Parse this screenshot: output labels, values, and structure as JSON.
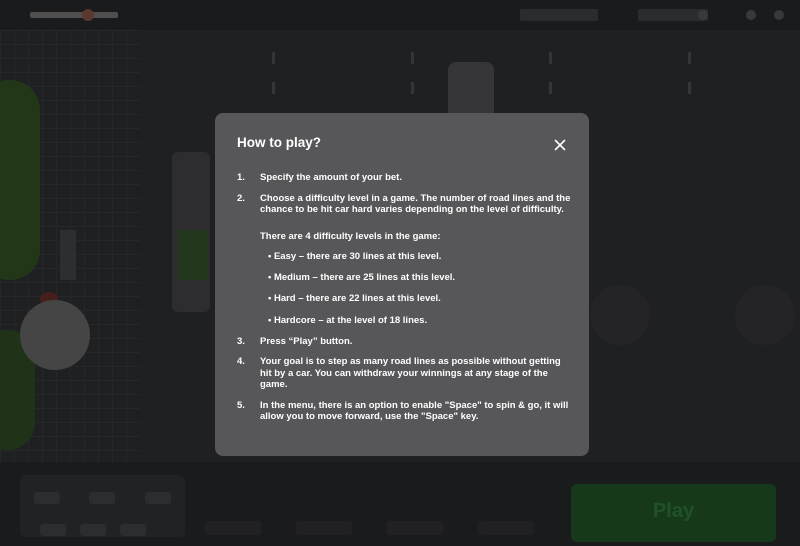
{
  "modal": {
    "title": "How to play?",
    "close_icon": "close-icon",
    "steps": [
      {
        "num": "1.",
        "text": "Specify the amount of your bet."
      },
      {
        "num": "2.",
        "text": "Choose a difficulty level in a game. The number of road lines and the chance to be hit car hard varies depending on the level of difficulty."
      },
      {
        "num": "3.",
        "text": "Press  “Play” button."
      },
      {
        "num": "4.",
        "text": "Your goal is to step as many road lines as possible without getting hit by a car. You can withdraw your winnings at any stage of the game."
      },
      {
        "num": "5.",
        "text": "In the menu, there is an option to enable \"Space\" to spin & go, it will allow you to move forward, use the \"Space\" key."
      }
    ],
    "levels_intro": "There are 4 difficulty levels in the game:",
    "levels": [
      "• Easy – there are 30 lines at this level.",
      "• Medium – there are 25 lines at this level.",
      "• Hard – there are 22 lines at this level.",
      "• Hardcore – at the level of 18 lines."
    ]
  },
  "game": {
    "play_label": "Play"
  }
}
